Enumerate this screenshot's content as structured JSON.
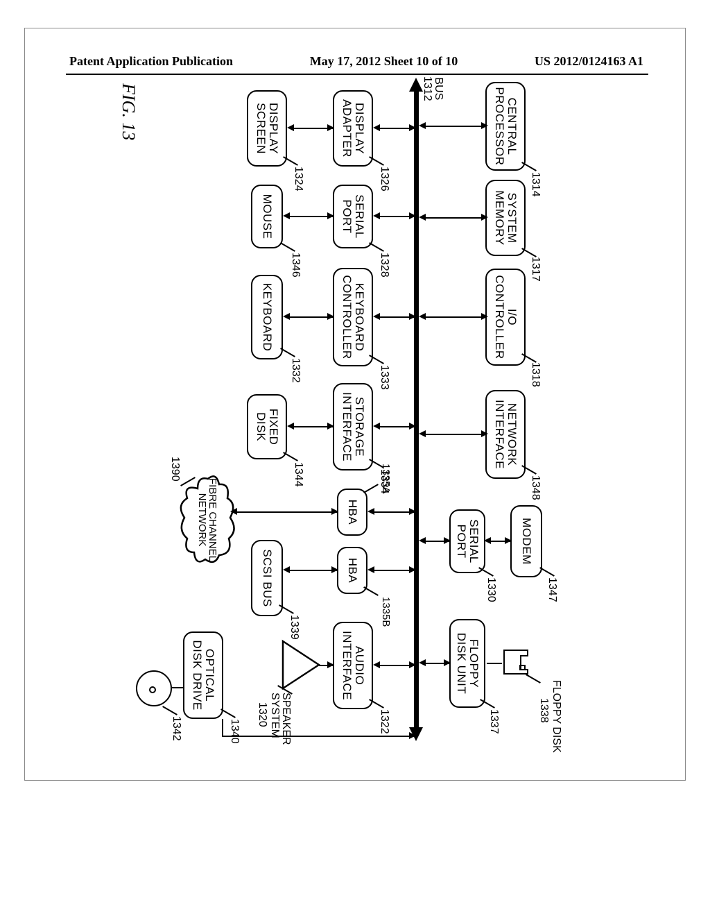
{
  "header": {
    "left": "Patent Application Publication",
    "center": "May 17, 2012  Sheet 10 of 10",
    "right": "US 2012/0124163 A1"
  },
  "figure_label": "FIG.  13",
  "bus_label": "BUS\n1312",
  "row1": {
    "central_processor": "CENTRAL\nPROCESSOR",
    "central_processor_ref": "1314",
    "system_memory": "SYSTEM\nMEMORY",
    "system_memory_ref": "1317",
    "io_controller": "I/O\nCONTROLLER",
    "io_controller_ref": "1318",
    "network_interface": "NETWORK\nINTERFACE",
    "network_interface_ref": "1348",
    "modem": "MODEM",
    "modem_ref": "1347",
    "serial_port_top": "SERIAL\nPORT",
    "serial_port_top_ref": "1330",
    "floppy_disk_unit": "FLOPPY\nDISK UNIT",
    "floppy_disk_unit_ref": "1337",
    "floppy_disk": "FLOPPY DISK",
    "floppy_disk_ref": "1338"
  },
  "row2": {
    "display_adapter": "DISPLAY\nADAPTER",
    "display_adapter_ref": "1326",
    "serial_port": "SERIAL\nPORT",
    "serial_port_ref": "1328",
    "keyboard_controller": "KEYBOARD\nCONTROLLER",
    "keyboard_controller_ref": "1333",
    "storage_interface": "STORAGE\nINTERFACE",
    "storage_interface_ref": "1334",
    "hba_a": "HBA",
    "hba_a_ref": "1335A",
    "hba_b": "HBA",
    "hba_b_ref": "1335B",
    "audio_interface": "AUDIO\nINTERFACE",
    "audio_interface_ref": "1322",
    "optical_disk_drive": "OPTICAL\nDISK DRIVE",
    "optical_disk_drive_ref": "1340",
    "optical_disc_ref": "1342"
  },
  "row3": {
    "display_screen": "DISPLAY\nSCREEN",
    "display_screen_ref": "1324",
    "mouse": "MOUSE",
    "mouse_ref": "1346",
    "keyboard": "KEYBOARD",
    "keyboard_ref": "1332",
    "fixed_disk": "FIXED\nDISK",
    "fixed_disk_ref": "1344",
    "scsi_bus": "SCSI BUS",
    "scsi_bus_ref": "1339",
    "fibre_channel": "FIBRE\nCHANNEL\nNETWORK",
    "fibre_channel_ref": "1390",
    "speaker_system": "SPEAKER\nSYSTEM",
    "speaker_system_ref": "1320"
  }
}
